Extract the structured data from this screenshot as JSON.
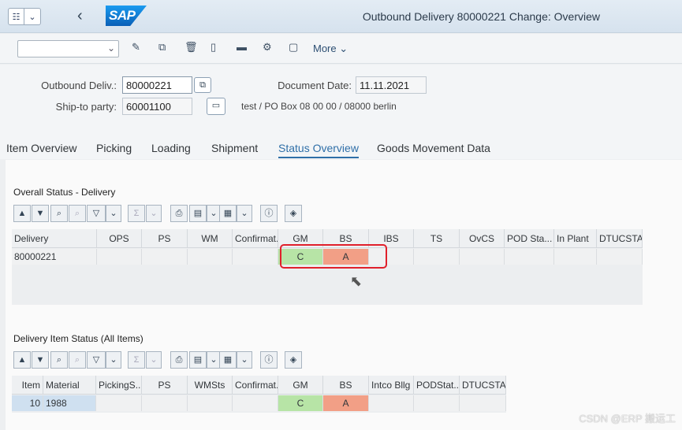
{
  "shell": {
    "title": "Outbound Delivery 80000221 Change: Overview",
    "logo": "SAP"
  },
  "toolbar": {
    "command_value": "",
    "more_label": "More"
  },
  "header": {
    "outbound_label": "Outbound Deliv.:",
    "outbound_value": "80000221",
    "docdate_label": "Document Date:",
    "docdate_value": "11.11.2021",
    "shipto_label": "Ship-to party:",
    "shipto_value": "60001100",
    "shipto_address": "test / PO Box 08 00 00 / 08000 berlin"
  },
  "tabs": [
    "Item Overview",
    "Picking",
    "Loading",
    "Shipment",
    "Status Overview",
    "Goods Movement Data"
  ],
  "overall": {
    "title": "Overall Status - Delivery",
    "columns": [
      "Delivery",
      "OPS",
      "PS",
      "WM",
      "Confirmat.",
      "GM",
      "BS",
      "IBS",
      "TS",
      "OvCS",
      "POD Sta...",
      "In Plant",
      "DTUCSTA"
    ],
    "row": [
      "80000221",
      "",
      "",
      "",
      "",
      "C",
      "A",
      "",
      "",
      "",
      "",
      "",
      ""
    ]
  },
  "items": {
    "title": "Delivery Item Status (All Items)",
    "columns": [
      "Item",
      "Material",
      "PickingS...",
      "PS",
      "WMSts",
      "Confirmat.",
      "GM",
      "BS",
      "Intco Bllg",
      "PODStat...",
      "DTUCSTA"
    ],
    "row": [
      "10",
      "1988",
      "",
      "",
      "",
      "",
      "C",
      "A",
      "",
      "",
      ""
    ]
  },
  "watermark": "CSDN @ERP 搬运工",
  "colors": {
    "green": "#b7e4a6",
    "red": "#f29f86",
    "accent": "#2f6fa8",
    "highlight": "#e0202b"
  }
}
